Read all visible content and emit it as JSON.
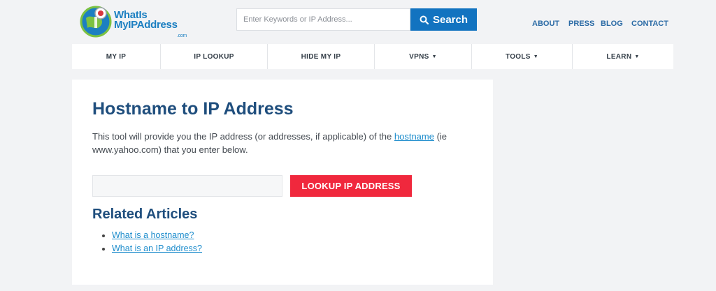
{
  "logo": {
    "line1": "WhatIs",
    "line2": "MyIPAddress",
    "suffix": ".com"
  },
  "search": {
    "placeholder": "Enter Keywords or IP Address...",
    "button_label": "Search"
  },
  "top_links": [
    "ABOUT",
    "PRESS",
    "BLOG",
    "CONTACT"
  ],
  "nav": [
    {
      "label": "MY IP",
      "dropdown": false
    },
    {
      "label": "IP LOOKUP",
      "dropdown": false
    },
    {
      "label": "HIDE MY IP",
      "dropdown": false
    },
    {
      "label": "VPNS",
      "dropdown": true
    },
    {
      "label": "TOOLS",
      "dropdown": true
    },
    {
      "label": "LEARN",
      "dropdown": true
    }
  ],
  "main": {
    "title": "Hostname to IP Address",
    "desc_before": "This tool will provide you the IP address (or addresses, if applicable) of the ",
    "desc_link": "hostname",
    "desc_after": " (ie www.yahoo.com) that you enter below.",
    "input_value": "",
    "lookup_button": "LOOKUP IP ADDRESS",
    "related_heading": "Related Articles",
    "related_links": [
      "What is a hostname?",
      "What is an IP address?"
    ]
  },
  "colors": {
    "brand": "#1273c0",
    "accent_red": "#f0283d",
    "heading": "#1f4e7d",
    "link": "#1c8ccc"
  }
}
